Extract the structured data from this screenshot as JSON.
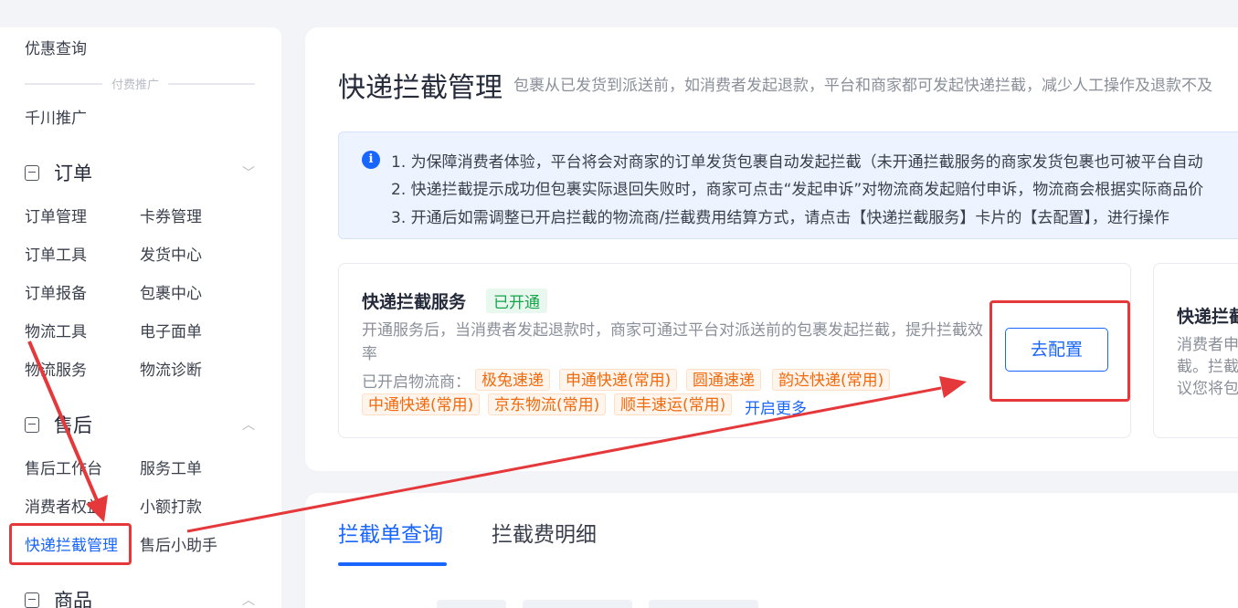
{
  "sidebar": {
    "items_top": [
      "优惠查询",
      "千川推广"
    ],
    "divider_label": "付费推广",
    "orders": {
      "title": "订单",
      "links": [
        "订单管理",
        "卡券管理",
        "订单工具",
        "发货中心",
        "订单报备",
        "包裹中心",
        "物流工具",
        "电子面单",
        "物流服务",
        "物流诊断"
      ]
    },
    "aftersale": {
      "title": "售后",
      "links": [
        "售后工作台",
        "服务工单",
        "消费者权益",
        "小额打款",
        "快递拦截管理",
        "售后小助手"
      ]
    },
    "goods": {
      "title": "商品"
    }
  },
  "page": {
    "title": "快递拦截管理",
    "subtitle": "包裹从已发货到派送前，如消费者发起退款，平台和商家都可发起快递拦截，减少人工操作及退款不及"
  },
  "notice": {
    "lines": [
      "1. 为保障消费者体验，平台将会对商家的订单发货包裹自动发起拦截（未开通拦截服务的商家发货包裹也可被平台自动",
      "2. 快递拦截提示成功但包裹实际退回失败时，商家可点击“发起申诉”对物流商发起赔付申诉，物流商会根据实际商品价",
      "3. 开通后如需调整已开启拦截的物流商/拦截费用结算方式，请点击【快递拦截服务】卡片的【去配置】，进行操作"
    ]
  },
  "service_card": {
    "title": "快递拦截服务",
    "status": "已开通",
    "description": "开通服务后，当消费者发起退款时，商家可通过平台对派送前的包裹发起拦截，提升拦截效率",
    "carriers_label": "已开启物流商：",
    "carriers": [
      "极兔速递",
      "申通快递(常用)",
      "圆通速递",
      "韵达快递(常用)",
      "中通快递(常用)",
      "京东物流(常用)",
      "顺丰速运(常用)"
    ],
    "more_link": "开启更多",
    "config_button": "去配置"
  },
  "second_card": {
    "title": "快递拦截",
    "desc_lines": [
      "消费者申",
      "截。拦截",
      "议您将包"
    ]
  },
  "tabs": [
    "拦截单查询",
    "拦截费明细"
  ],
  "colors": {
    "accent": "#1966ff",
    "annotation": "#e5383b",
    "success": "#16a34a",
    "chip": "#f26a0e"
  }
}
